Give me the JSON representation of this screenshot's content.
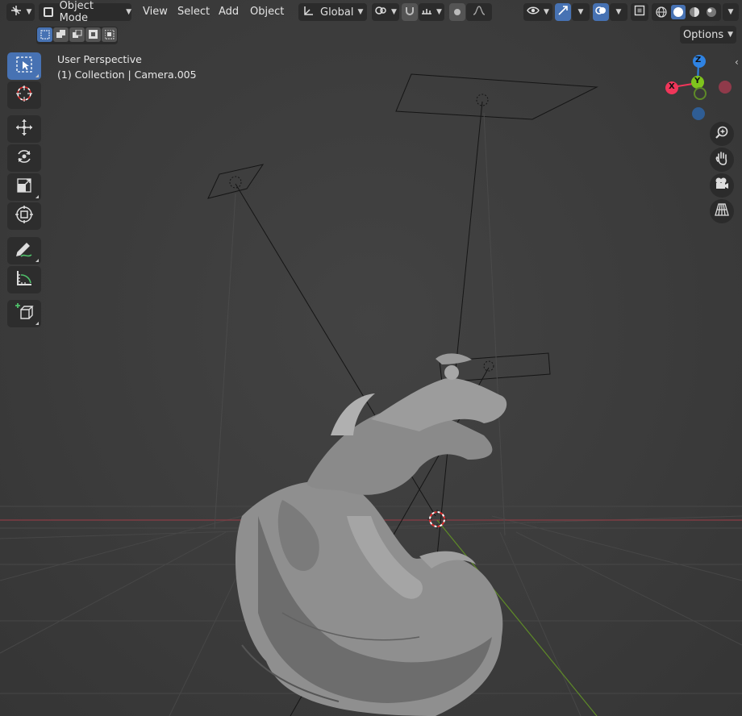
{
  "header": {
    "editor_type_icon": "view3d-icon",
    "mode": "Object Mode",
    "menus": [
      "View",
      "Select",
      "Add",
      "Object"
    ],
    "transform_orientation": "Global",
    "options_label": "Options"
  },
  "overlay": {
    "view_name": "User Perspective",
    "object_info": "(1) Collection | Camera.005"
  },
  "gizmo": {
    "x_label": "X",
    "y_label": "Y",
    "z_label": "Z",
    "colors": {
      "x": "#f0365a",
      "y": "#7fc41d",
      "z": "#2f83e3"
    }
  },
  "toolbar": {
    "tools": [
      "select-box",
      "cursor",
      "move",
      "rotate",
      "scale",
      "transform",
      "annotate",
      "measure",
      "add-cube"
    ],
    "active": "select-box"
  },
  "shading": {
    "modes": [
      "wireframe",
      "solid",
      "material-preview",
      "rendered"
    ],
    "active": "solid"
  },
  "colors": {
    "accent": "#4772b3",
    "background": "#3d3d3d",
    "panel": "#2b2b2b"
  }
}
